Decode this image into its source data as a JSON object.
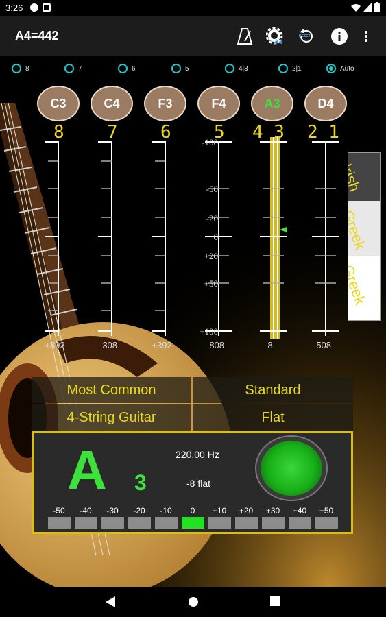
{
  "status": {
    "time": "3:26"
  },
  "appbar": {
    "title": "A4=442",
    "a4_badge": "A4",
    "reset_badge": "RESET"
  },
  "radios": [
    {
      "label": "8",
      "selected": false
    },
    {
      "label": "7",
      "selected": false
    },
    {
      "label": "6",
      "selected": false
    },
    {
      "label": "5",
      "selected": false
    },
    {
      "label": "4|3",
      "selected": false
    },
    {
      "label": "2|1",
      "selected": false
    },
    {
      "label": "Auto",
      "selected": true
    }
  ],
  "strings": [
    {
      "note": "C3",
      "nums": "8",
      "cents": "+892",
      "active": false
    },
    {
      "note": "C4",
      "nums": "7",
      "cents": "-308",
      "active": false
    },
    {
      "note": "F3",
      "nums": "6",
      "cents": "+392",
      "active": false
    },
    {
      "note": "F4",
      "nums": "5",
      "cents": "-808",
      "active": false
    },
    {
      "note": "A3",
      "nums": "4 3",
      "cents": "-8",
      "active": true
    },
    {
      "note": "D4",
      "nums": "2 1",
      "cents": "-508",
      "active": false
    }
  ],
  "scale_labels": [
    "-100",
    "-50",
    "-20",
    "0",
    "+20",
    "+50",
    "+100"
  ],
  "side_tab": {
    "top": "Irish",
    "mid": "Greek",
    "bottom": "Greek"
  },
  "tuning": {
    "row1": [
      "Most Common",
      "Standard"
    ],
    "row2": [
      "4-String Guitar",
      "Flat"
    ]
  },
  "display": {
    "note": "A",
    "octave": "3",
    "frequency": "220.00 Hz",
    "deviation": "-8 flat",
    "meter_labels": [
      "-50",
      "-40",
      "-30",
      "-20",
      "-10",
      "0",
      "+10",
      "+20",
      "+30",
      "+40",
      "+50"
    ],
    "meter_active_index": 5
  },
  "colors": {
    "accent": "#26c6c6",
    "note_green": "#3ee03e",
    "yellow": "#e8d820"
  }
}
